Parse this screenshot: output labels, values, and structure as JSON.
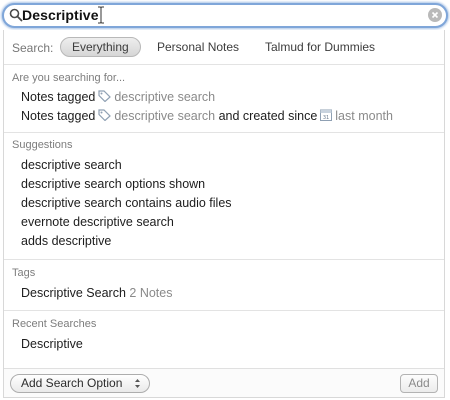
{
  "search": {
    "value": "Descriptive"
  },
  "scope": {
    "label": "Search:",
    "options": [
      "Everything",
      "Personal Notes",
      "Talmud for Dummies"
    ],
    "selected": "Everything"
  },
  "searching_for": {
    "title": "Are you searching for...",
    "items": [
      {
        "prefix": "Notes tagged",
        "tag": "descriptive search"
      },
      {
        "prefix": "Notes tagged",
        "tag": "descriptive search",
        "middle": "and created since",
        "date": "last month"
      }
    ]
  },
  "suggestions": {
    "title": "Suggestions",
    "items": [
      "descriptive search",
      "descriptive search options shown",
      "descriptive search contains audio files",
      "evernote descriptive search",
      "adds descriptive"
    ]
  },
  "tags": {
    "title": "Tags",
    "items": [
      {
        "name": "Descriptive Search",
        "count": "2 Notes"
      }
    ]
  },
  "recent": {
    "title": "Recent Searches",
    "items": [
      "Descriptive"
    ]
  },
  "footer": {
    "add_option_label": "Add Search Option",
    "add_label": "Add"
  },
  "colors": {
    "focus_ring": "#7fa6d9",
    "muted_text": "#8a8a8a"
  },
  "icons": [
    "search-icon",
    "text-cursor-icon",
    "clear-icon",
    "tag-icon",
    "calendar-icon",
    "stepper-icon"
  ]
}
